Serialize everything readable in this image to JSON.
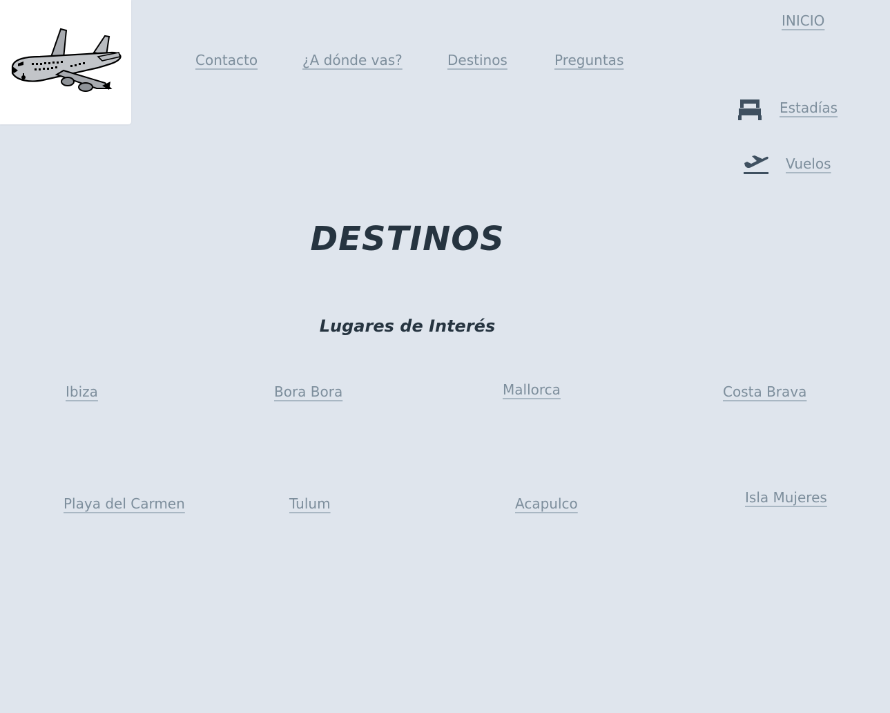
{
  "header": {
    "inicio_label": "INICIO",
    "nav": {
      "contacto": "Contacto",
      "a_donde_vas": "¿A dónde vas?",
      "destinos": "Destinos",
      "preguntas": "Preguntas"
    },
    "side": {
      "estadias": "Estadías",
      "vuelos": "Vuelos"
    }
  },
  "main": {
    "title": "DESTINOS",
    "subtitle": "Lugares de Interés",
    "places": {
      "ibiza": "Ibiza",
      "bora_bora": "Bora Bora",
      "mallorca": "Mallorca",
      "costa_brava": "Costa Brava",
      "playa_del_carmen": "Playa del Carmen",
      "tulum": "Tulum",
      "acapulco": "Acapulco",
      "isla_mujeres": "Isla Mujeres"
    }
  },
  "colors": {
    "background": "#dfe5ed",
    "link": "#7d8e9c",
    "heading": "#263440",
    "icon": "#3f5060"
  },
  "icons": {
    "logo": "airplane-logo",
    "estadias": "bed-icon",
    "vuelos": "plane-takeoff-icon"
  }
}
